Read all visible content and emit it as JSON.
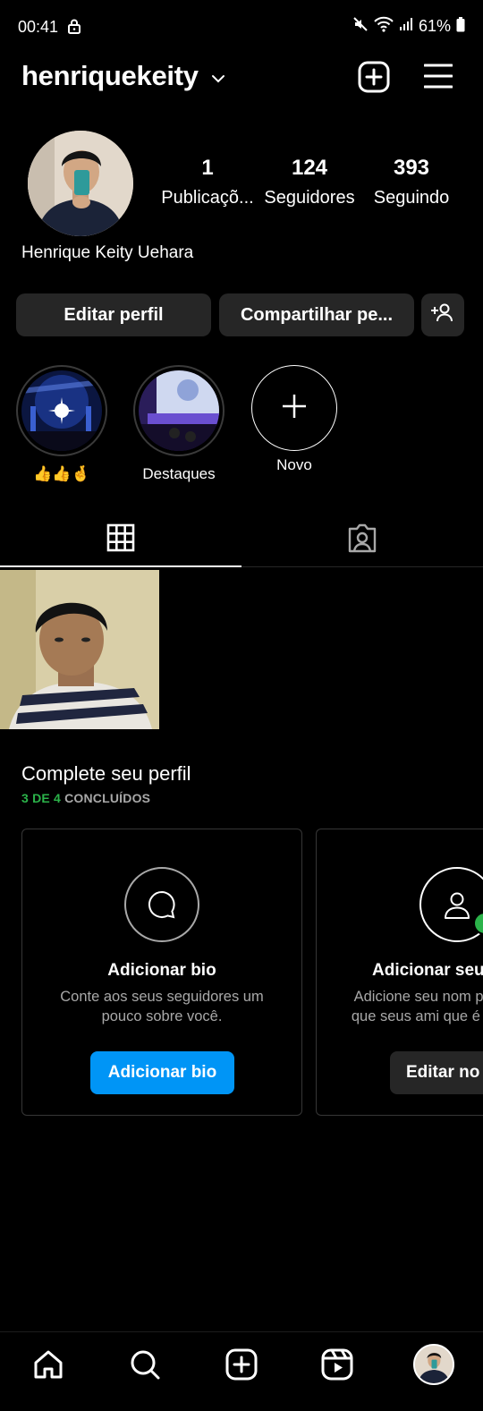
{
  "status_bar": {
    "time": "00:41",
    "battery": "61%",
    "icons": [
      "lock-icon",
      "mute-icon",
      "wifi-icon",
      "signal-icon",
      "battery-icon"
    ]
  },
  "header": {
    "username": "henriquekeity",
    "icons": [
      "chevron-down-icon",
      "new-post-icon",
      "menu-icon"
    ]
  },
  "profile": {
    "full_name": "Henrique Keity Uehara",
    "stats": [
      {
        "value": "1",
        "label": "Publicaçõ..."
      },
      {
        "value": "124",
        "label": "Seguidores"
      },
      {
        "value": "393",
        "label": "Seguindo"
      }
    ]
  },
  "actions": {
    "edit_profile": "Editar perfil",
    "share_profile": "Compartilhar pe...",
    "discover_people_icon": "add-person-icon"
  },
  "highlights": [
    {
      "label": "👍👍🤞",
      "type": "image",
      "scene": "concert"
    },
    {
      "label": "Destaques",
      "type": "image",
      "scene": "stage"
    },
    {
      "label": "Novo",
      "type": "new",
      "icon": "plus-icon"
    }
  ],
  "tabs": [
    {
      "name": "grid",
      "icon": "grid-icon",
      "active": true
    },
    {
      "name": "tagged",
      "icon": "tagged-person-icon",
      "active": false
    }
  ],
  "complete_profile": {
    "title": "Complete seu perfil",
    "progress_highlight": "3 DE 4",
    "progress_rest": " CONCLUÍDOS",
    "cards": [
      {
        "icon": "chat-bubble-icon",
        "title": "Adicionar bio",
        "description": "Conte aos seus seguidores um pouco sobre você.",
        "button": "Adicionar bio",
        "button_color": "#0095f6"
      },
      {
        "icon": "user-icon",
        "title": "Adicionar seu",
        "description": "Adicione seu nom para que seus ami que é voc",
        "button": "Editar no",
        "button_color": "#262626",
        "completed": true
      }
    ]
  },
  "bottom_nav": [
    {
      "icon": "home-icon"
    },
    {
      "icon": "search-icon"
    },
    {
      "icon": "create-icon"
    },
    {
      "icon": "reels-icon"
    },
    {
      "icon": "profile-avatar"
    }
  ],
  "colors": {
    "background": "#000000",
    "surface": "#262626",
    "primary_button": "#0095f6",
    "success": "#2bb34a",
    "secondary_text": "#a8a8a8"
  }
}
